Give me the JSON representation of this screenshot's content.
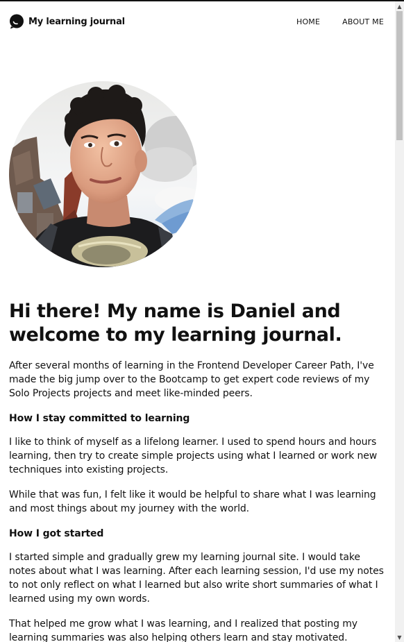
{
  "header": {
    "brand_title": "My learning journal",
    "logo_icon": "speech-bubble-icon",
    "nav": [
      {
        "label": "HOME"
      },
      {
        "label": "ABOUT ME"
      }
    ]
  },
  "hero": {
    "image_description_icon": "profile-photo"
  },
  "main": {
    "title": "Hi there! My name is Daniel and welcome to my learning journal.",
    "intro": "After several months of learning in the Frontend Developer Career Path, I've made the big jump over to the Bootcamp to get expert code reviews of my Solo Projects projects and meet like-minded peers.",
    "sections": [
      {
        "heading": "How I stay committed to learning",
        "paragraphs": [
          "I like to think of myself as a lifelong learner. I used to spend hours and hours learning, then try to create simple projects using what I learned or work new techniques into existing projects.",
          "While that was fun, I felt like it would be helpful to share what I was learning and most things about my journey with the world."
        ]
      },
      {
        "heading": "How I got started",
        "paragraphs": [
          "I started simple and gradually grew my learning journal site. I would take notes about what I was learning. After each learning session, I'd use my notes to not only reflect on what I learned but also write short summaries of what I learned using my own words.",
          "That helped me grow what I was learning, and I realized that posting my learning summaries was also helping others learn and stay motivated."
        ]
      }
    ]
  },
  "colors": {
    "text": "#111111",
    "background": "#ffffff",
    "scrollbar_track": "#f1f1f1",
    "scrollbar_thumb": "#c1c1c1"
  }
}
